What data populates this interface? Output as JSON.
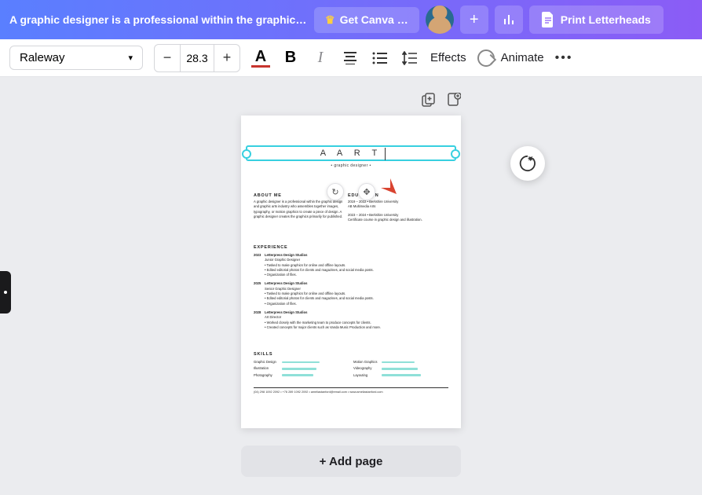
{
  "header": {
    "doc_title": "A graphic designer is a professional within the graphic …",
    "canva_btn": "Get Canva …",
    "print_btn": "Print Letterheads"
  },
  "toolbar": {
    "font": "Raleway",
    "size": "28.3",
    "effects": "Effects",
    "animate": "Animate"
  },
  "canvas": {
    "add_page": "+ Add page"
  },
  "resume": {
    "title": "A A R T",
    "subtitle": "• graphic designer •",
    "about_h": "ABOUT ME",
    "about_p": "A graphic designer is a professional within the graphic design and graphic arts industry who assembles together images, typography, or motion graphics to create a piece of design. A graphic designer creates the graphics primarily for published.",
    "edu_h": "EDUCATION",
    "edu1": "2019 – 2022 • Berkshire University",
    "edu1b": "AB Multimedia Arts",
    "edu2": "2023 – 2024 • Berkshire University",
    "edu2b": "Certificate course in graphic design and illustration.",
    "exp_h": "EXPERIENCE",
    "y1": "2023",
    "c1": "Letterpress Design Studios",
    "r1": "Junior Graphic Designer",
    "b11": "• Tasked to make graphics for online and offline layouts.",
    "b12": "• Edited editorial photos for clients and magazines, and social media posts.",
    "b13": "• Organization of files.",
    "y2": "2025",
    "c2": "Letterpress Design Studios",
    "r2": "Senior Graphic Designer",
    "b21": "• Tasked to make graphics for online and offline layouts.",
    "b22": "• Edited editorial photos for clients and magazines, and social media posts.",
    "b23": "• Organization of files.",
    "y3": "2028",
    "c3": "Letterpress Design Studios",
    "r3": "Art Director",
    "b31": "• Worked closely with the marketing team to produce concepts for clients.",
    "b32": "• Created concepts for major clients such as Vanda Music Production and more.",
    "skills_h": "SKILLS",
    "s1": "Graphic Design",
    "s2": "Illustration",
    "s3": "Photography",
    "s4": "Motion Graphics",
    "s5": "Videography",
    "s6": "Layouting",
    "footer": "(04) 298 1092 2092 • +76 289 1092 2092 • ameliastanford@email.com • www.ameliastanford.com"
  }
}
